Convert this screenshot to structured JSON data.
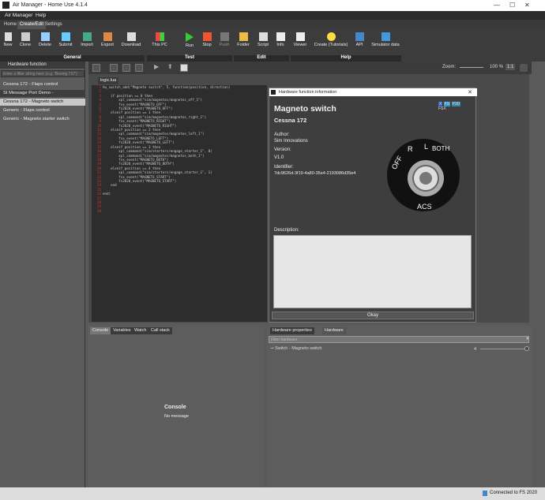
{
  "app": {
    "title": "Air Manager - Home Use 4.1.4"
  },
  "menu": [
    "Air Manager",
    "Help"
  ],
  "tabs": [
    "Home",
    "Create/Edit",
    "Settings"
  ],
  "ribbon": {
    "general": [
      "New",
      "Clone",
      "Delete",
      "Submit",
      "Import",
      "Export",
      "Download"
    ],
    "test": [
      "This PC",
      "Run",
      "Stop",
      "Push"
    ],
    "edit": [
      "Folder",
      "Script",
      "Info"
    ],
    "help": [
      "Viewer",
      "Create (Tutorials)",
      "API",
      "Simulator data"
    ],
    "groups": {
      "general": "General",
      "test": "Test",
      "edit": "Edit",
      "help": "Help"
    }
  },
  "left": {
    "header": "Hardware function",
    "search_placeholder": "Enter a filter string here (e.g. 'Boeing 737')",
    "items": [
      {
        "label": "Cessna 172 - Flaps control",
        "type": "item"
      },
      {
        "label": "SI Message Port Demo -",
        "type": "group"
      },
      {
        "label": "Cessna 172 - Magneto switch",
        "type": "selected"
      },
      {
        "label": "Generic - Flaps control",
        "type": "item"
      },
      {
        "label": "Generic - Magneto starter switch",
        "type": "item"
      }
    ]
  },
  "toolbar2": {
    "zoom_label": "Zoom:",
    "zoom_value": "100 %",
    "ratio": "1:1"
  },
  "editor": {
    "file_tab": "logic.lua",
    "line_numbers": [
      "1",
      "2",
      "3",
      "4",
      "5",
      "6",
      "7",
      "8",
      "9",
      "10",
      "11",
      "12",
      "13",
      "14",
      "15",
      "16",
      "17",
      "18",
      "19",
      "20",
      "21",
      "22",
      "23",
      "24",
      "25",
      "26",
      "27",
      "28",
      "29",
      "30"
    ],
    "code": "hw_switch_add(\"Magneto switch\", 5, function(position, direction)\n\n    if position == 0 then\n        xpl_command(\"sim/magnetos/magnetos_off_1\")\n        fsx_event(\"MAGNETO_OFF\")\n        fs2020_event(\"MAGNETO_OFF\")\n    elseif position == 1 then\n        xpl_command(\"sim/magnetos/magnetos_right_1\")\n        fsx_event(\"MAGNETO_RIGHT\")\n        fs2020_event(\"MAGNETO_RIGHT\")\n    elseif position == 2 then\n        xpl_command(\"sim/magnetos/magnetos_left_1\")\n        fsx_event(\"MAGNETO_LEFT\")\n        fs2020_event(\"MAGNETO_LEFT\")\n    elseif position == 3 then\n        xpl_command(\"sim/starters/engage_starter_1\", 0)\n        xpl_command(\"sim/magnetos/magnetos_both_1\")\n        fsx_event(\"MAGNETO_BOTH\")\n        fs2020_event(\"MAGNETO_BOTH\")\n    elseif position == 4 then\n        xpl_command(\"sim/starters/engage_starter_1\", 1)\n        fsx_event(\"MAGNETO_START\")\n        fs2020_event(\"MAGNETO_START\")\n    end\n\nend)"
  },
  "dialog": {
    "title": "Hardware function information",
    "heading": "Magneto switch",
    "subheading": "Cessna 172",
    "author_label": "Author:",
    "author": "Sim Innovations",
    "version_label": "Version:",
    "version": "V1.0",
    "identifier_label": "Identifier:",
    "identifier": "7dc9626d-3f19-4a80-35e4-2193086d35e4",
    "description_label": "Description:",
    "ok": "Okay",
    "badges": [
      "X",
      "FS",
      "P3D",
      "FSX"
    ],
    "switch_labels": {
      "off": "OFF",
      "r": "R",
      "l": "L",
      "both": "BOTH",
      "acs": "ACS"
    }
  },
  "bottom_left": {
    "tabs": [
      "Console",
      "Variables",
      "Watch",
      "Call stack"
    ],
    "console_title": "Console",
    "console_msg": "No message"
  },
  "bottom_right": {
    "tabs": [
      "Hardware properties",
      "Hardware"
    ],
    "filter_placeholder": "Filter hardware",
    "row_label": "Switch - Magneto switch",
    "row_value": "4",
    "slider_fraction": 1.0
  },
  "status": {
    "text": "Connected to FS 2020"
  }
}
